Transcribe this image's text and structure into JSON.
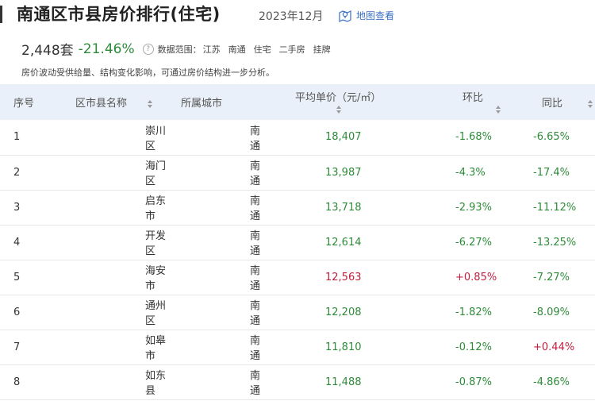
{
  "header": {
    "title": "南通区市县房价排行(住宅)",
    "period": "2023年12月",
    "map_link": "地图查看"
  },
  "summary": {
    "count": "2,448套",
    "change": "-21.46%",
    "scope_label": "数据范围：",
    "tags": [
      "江苏",
      "南通",
      "住宅",
      "二手房",
      "挂牌"
    ],
    "note": "房价波动受供给量、结构变化影响，可通过房价结构进一步分析。"
  },
  "table": {
    "headers": {
      "index": "序号",
      "district": "区市县名称",
      "city": "所属城市",
      "price": "平均单价（元/㎡）",
      "mom": "环比",
      "yoy": "同比"
    },
    "rows": [
      {
        "index": "1",
        "district": "崇川区",
        "city": "南通",
        "price": "18,407",
        "mom": "-1.68%",
        "yoy": "-6.65%"
      },
      {
        "index": "2",
        "district": "海门区",
        "city": "南通",
        "price": "13,987",
        "mom": "-4.3%",
        "yoy": "-17.4%"
      },
      {
        "index": "3",
        "district": "启东市",
        "city": "南通",
        "price": "13,718",
        "mom": "-2.93%",
        "yoy": "-11.12%"
      },
      {
        "index": "4",
        "district": "开发区",
        "city": "南通",
        "price": "12,614",
        "mom": "-6.27%",
        "yoy": "-13.25%"
      },
      {
        "index": "5",
        "district": "海安市",
        "city": "南通",
        "price": "12,563",
        "mom": "+0.85%",
        "yoy": "-7.27%"
      },
      {
        "index": "6",
        "district": "通州区",
        "city": "南通",
        "price": "12,208",
        "mom": "-1.82%",
        "yoy": "-8.09%"
      },
      {
        "index": "7",
        "district": "如皋市",
        "city": "南通",
        "price": "11,810",
        "mom": "-0.12%",
        "yoy": "+0.44%"
      },
      {
        "index": "8",
        "district": "如东县",
        "city": "南通",
        "price": "11,488",
        "mom": "-0.87%",
        "yoy": "-4.86%"
      }
    ]
  },
  "colors": {
    "up": "#c0203c",
    "down": "#2e8b3a",
    "header_bg": "#eaf0f9",
    "link": "#3a6fc4"
  }
}
